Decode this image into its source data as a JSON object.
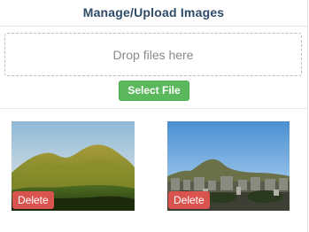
{
  "header": {
    "title": "Manage/Upload Images"
  },
  "upload": {
    "dropzone_text": "Drop files here",
    "select_label": "Select File"
  },
  "gallery": {
    "images": [
      {
        "delete_label": "Delete"
      },
      {
        "delete_label": "Delete"
      }
    ]
  },
  "colors": {
    "title": "#2d4a66",
    "select_button": "#5cb85c",
    "delete_button": "#d9534f"
  }
}
